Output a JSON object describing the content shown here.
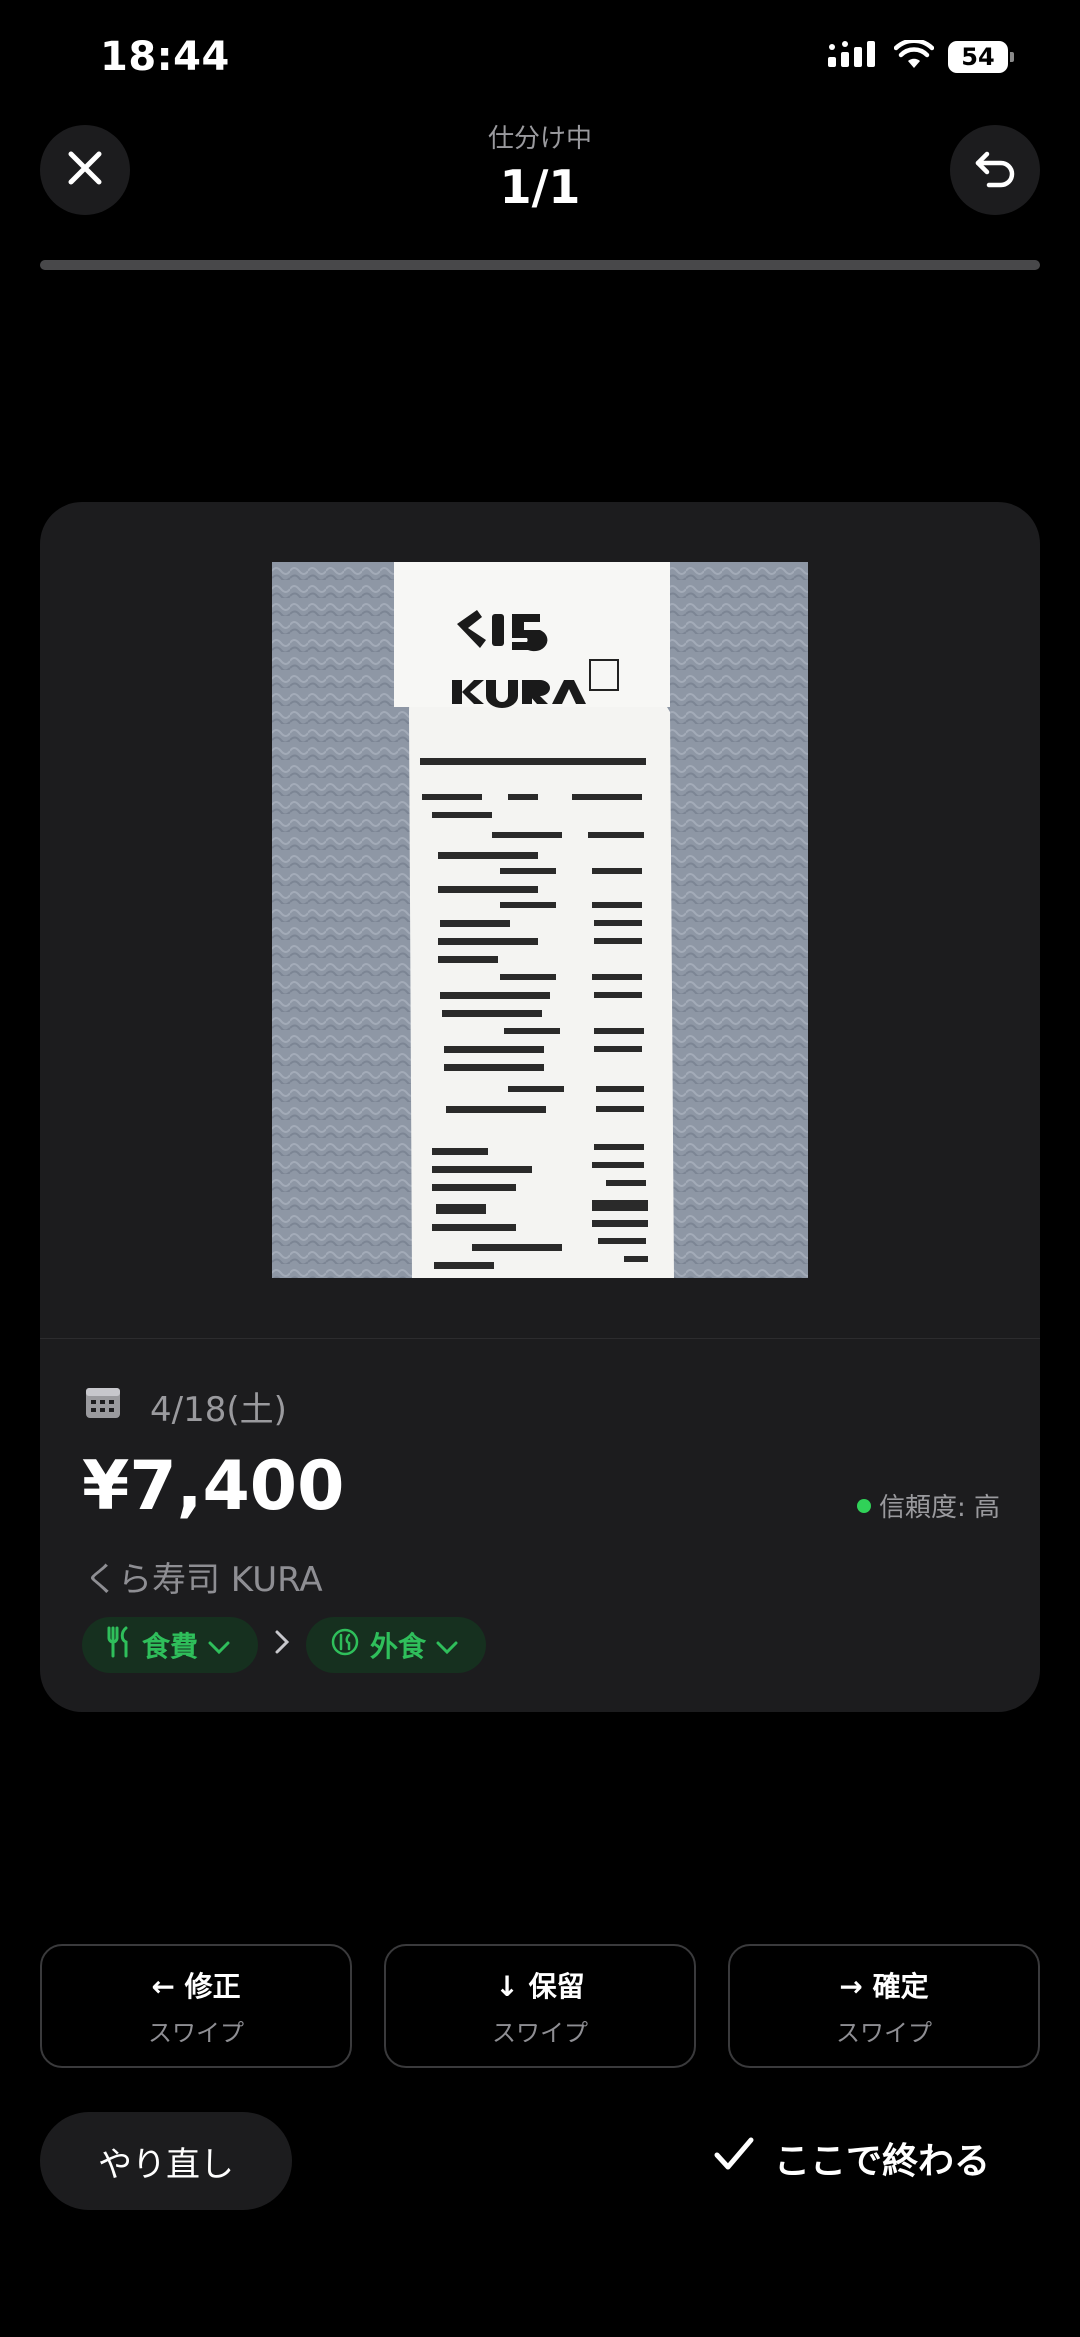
{
  "status_bar": {
    "time": "18:44",
    "battery": "54"
  },
  "header": {
    "subtitle": "仕分け中",
    "title": "1/1",
    "progress_fraction": 1.0
  },
  "receipt": {
    "image_icon": "receipt-photo",
    "date": "4/18(土)",
    "amount": "¥7,400",
    "confidence_label": "信頼度: 高",
    "confidence_color": "#30d158",
    "merchant": "くら寿司 KURA",
    "category": "食費",
    "subcategory": "外食"
  },
  "actions": {
    "edit": {
      "title": "← 修正",
      "hint": "スワイプ"
    },
    "hold": {
      "title": "↓ 保留",
      "hint": "スワイプ"
    },
    "confirm": {
      "title": "→ 確定",
      "hint": "スワイプ"
    }
  },
  "footer": {
    "redo_label": "やり直し",
    "finish_label": "ここで終わる"
  },
  "colors": {
    "accent_green": "#30d158",
    "chip_bg": "#16301f",
    "card_bg": "#1c1c1e"
  }
}
